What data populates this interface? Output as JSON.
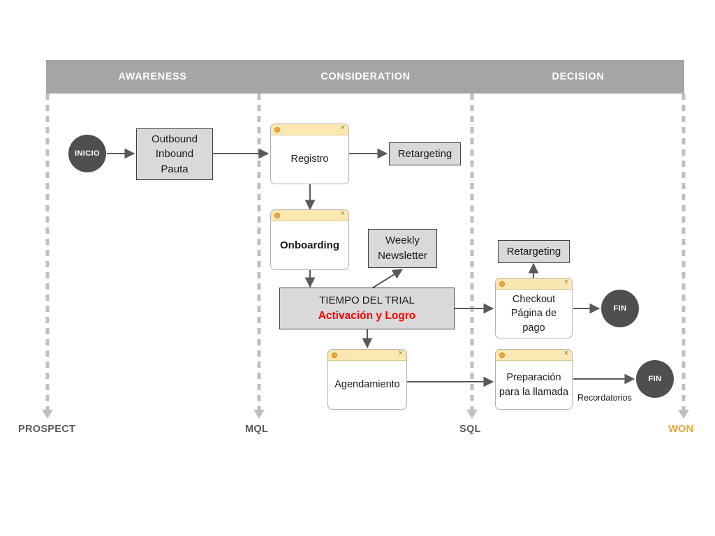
{
  "stages": [
    {
      "id": "awareness",
      "band_label": "AWARENESS",
      "footer_label": "PROSPECT"
    },
    {
      "id": "consideration",
      "band_label": "CONSIDERATION",
      "footer_label": "MQL"
    },
    {
      "id": "decision",
      "band_label": "DECISION",
      "footer_label": "SQL"
    },
    {
      "id": "won",
      "band_label": "",
      "footer_label": "WON"
    }
  ],
  "nodes": {
    "inicio": {
      "label": "INICIO"
    },
    "outbound": {
      "line1": "Outbound",
      "line2": "Inbound",
      "line3": "Pauta"
    },
    "registro": {
      "label": "Registro"
    },
    "retargeting_1": {
      "label": "Retargeting"
    },
    "onboarding": {
      "label": "Onboarding"
    },
    "weekly": {
      "line1": "Weekly",
      "line2": "Newsletter"
    },
    "trial": {
      "line1": "TIEMPO DEL TRIAL",
      "line2": "Activación y Logro"
    },
    "retargeting_2": {
      "label": "Retargeting"
    },
    "checkout": {
      "line1": "Checkout",
      "line2": "Página de pago"
    },
    "agendamiento": {
      "label": "Agendamiento"
    },
    "preparacion": {
      "line1": "Preparación",
      "line2": "para la llamada"
    },
    "fin_top": {
      "label": "FIN"
    },
    "fin_bottom": {
      "label": "FIN"
    }
  },
  "edge_labels": {
    "recordatorios": "Recordatorios"
  },
  "window_chrome": {
    "close_glyph": "×"
  },
  "colors": {
    "band_fill": "#a5a5a5",
    "band_text": "#ffffff",
    "box_fill": "#d9d9d9",
    "box_stroke": "#404040",
    "window_titlebar": "#fbe8b0",
    "window_dot": "#eda93f",
    "circle_fill": "#4f4f4f",
    "accent_red": "#ff0000",
    "won_gold": "#e8a72b",
    "divider_gray": "#bfbfbf",
    "connector": "#595959"
  }
}
